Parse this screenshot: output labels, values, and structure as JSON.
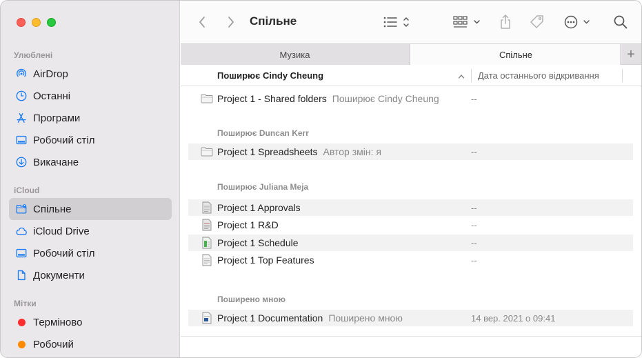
{
  "window": {
    "title": "Спільне"
  },
  "sidebar": {
    "sections": [
      {
        "title": "Улюблені",
        "items": [
          {
            "label": "AirDrop",
            "icon": "airdrop-icon"
          },
          {
            "label": "Останні",
            "icon": "clock-icon"
          },
          {
            "label": "Програми",
            "icon": "applications-icon"
          },
          {
            "label": "Робочий стіл",
            "icon": "desktop-icon"
          },
          {
            "label": "Викачане",
            "icon": "download-icon"
          }
        ]
      },
      {
        "title": "iCloud",
        "items": [
          {
            "label": "Спільне",
            "icon": "shared-folder-icon",
            "selected": true
          },
          {
            "label": "iCloud Drive",
            "icon": "cloud-icon"
          },
          {
            "label": "Робочий стіл",
            "icon": "desktop-icon"
          },
          {
            "label": "Документи",
            "icon": "document-icon"
          }
        ]
      },
      {
        "title": "Мітки",
        "items": [
          {
            "label": "Терміново",
            "color": "#ff3b30"
          },
          {
            "label": "Робочий",
            "color": "#ff9500"
          }
        ]
      }
    ]
  },
  "tabs": [
    {
      "label": "Музика",
      "active": false
    },
    {
      "label": "Спільне",
      "active": true
    }
  ],
  "columns": {
    "name": "Поширює Cindy Cheung",
    "date": "Дата останнього відкривання"
  },
  "groups": [
    {
      "title": "",
      "rows": [
        {
          "name": "Project 1 - Shared folders",
          "sub": "Поширює Cindy Cheung",
          "date": "--",
          "icon": "folder-icon"
        }
      ]
    },
    {
      "title": "Поширює Duncan Kerr",
      "rows": [
        {
          "name": "Project 1 Spreadsheets",
          "sub": "Автор змін: я",
          "date": "--",
          "icon": "folder-icon"
        }
      ]
    },
    {
      "title": "Поширює Juliana Meja",
      "rows": [
        {
          "name": "Project 1 Approvals",
          "sub": "",
          "date": "--",
          "icon": "pdf-file-icon"
        },
        {
          "name": "Project 1 R&D",
          "sub": "",
          "date": "--",
          "icon": "pdf-file-icon"
        },
        {
          "name": "Project 1 Schedule",
          "sub": "",
          "date": "--",
          "icon": "numbers-file-icon"
        },
        {
          "name": "Project 1 Top Features",
          "sub": "",
          "date": "--",
          "icon": "text-file-icon"
        }
      ]
    },
    {
      "title": "Поширено мною",
      "rows": [
        {
          "name": "Project 1 Documentation",
          "sub": "Поширено мною",
          "date": "14 вер. 2021 о 09:41",
          "icon": "word-file-icon"
        }
      ]
    }
  ],
  "colors": {
    "sidebar_bg": "#ebe8eb",
    "selected_bg": "#d2cfd2",
    "accent": "#1a7cf5"
  }
}
